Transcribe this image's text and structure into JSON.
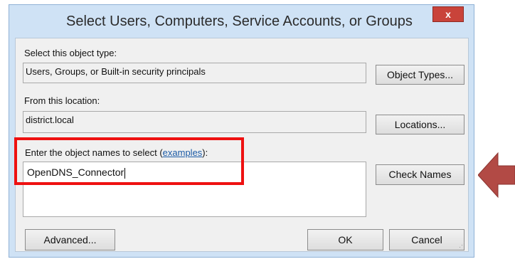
{
  "dialog": {
    "title": "Select Users, Computers, Service Accounts, or Groups",
    "close_label": "x"
  },
  "object_type": {
    "label": "Select this object type:",
    "value": "Users, Groups, or Built-in security principals",
    "button": "Object Types..."
  },
  "location": {
    "label": "From this location:",
    "value": "district.local",
    "button": "Locations..."
  },
  "names": {
    "label_prefix": "Enter the object names to select (",
    "label_link": "examples",
    "label_suffix": "):",
    "value": "OpenDNS_Connector",
    "check_button": "Check Names"
  },
  "footer": {
    "advanced": "Advanced...",
    "ok": "OK",
    "cancel": "Cancel"
  },
  "colors": {
    "highlight": "#ee1111",
    "arrow": "#b24a45",
    "close": "#c9433a"
  },
  "icons": {
    "close": "close-icon",
    "arrow": "left-arrow-icon",
    "grip": "resize-grip-icon"
  }
}
